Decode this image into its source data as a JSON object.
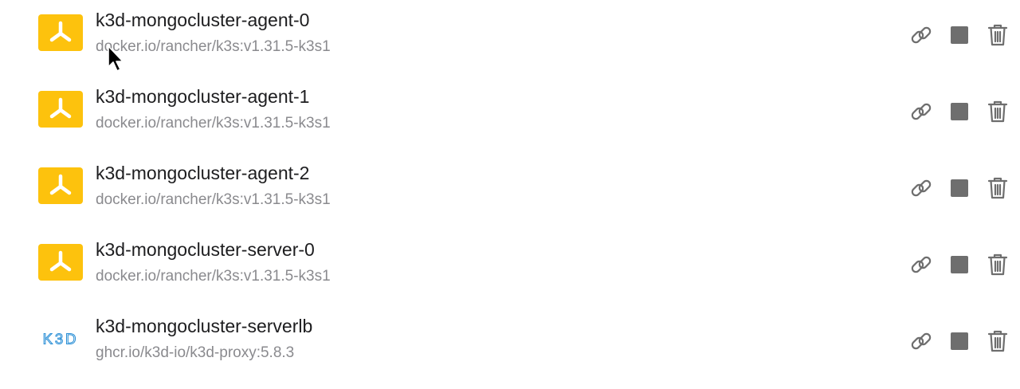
{
  "containers": [
    {
      "name": "k3d-mongocluster-agent-0",
      "image": "docker.io/rancher/k3s:v1.31.5-k3s1",
      "icon": "k3s-logo-icon"
    },
    {
      "name": "k3d-mongocluster-agent-1",
      "image": "docker.io/rancher/k3s:v1.31.5-k3s1",
      "icon": "k3s-logo-icon"
    },
    {
      "name": "k3d-mongocluster-agent-2",
      "image": "docker.io/rancher/k3s:v1.31.5-k3s1",
      "icon": "k3s-logo-icon"
    },
    {
      "name": "k3d-mongocluster-server-0",
      "image": "docker.io/rancher/k3s:v1.31.5-k3s1",
      "icon": "k3s-logo-icon"
    },
    {
      "name": "k3d-mongocluster-serverlb",
      "image": "ghcr.io/k3d-io/k3d-proxy:5.8.3",
      "icon": "k3d-logo-icon",
      "logo_text": "K3D"
    }
  ],
  "actions": {
    "link_icon": "link-icon",
    "stop_icon": "stop-icon",
    "delete_icon": "trash-icon"
  },
  "colors": {
    "k3s_badge": "#FDC20D",
    "icon_gray": "#6e6e6e",
    "title_text": "#1d1d1f",
    "subtitle_text": "#8a8a8e"
  }
}
